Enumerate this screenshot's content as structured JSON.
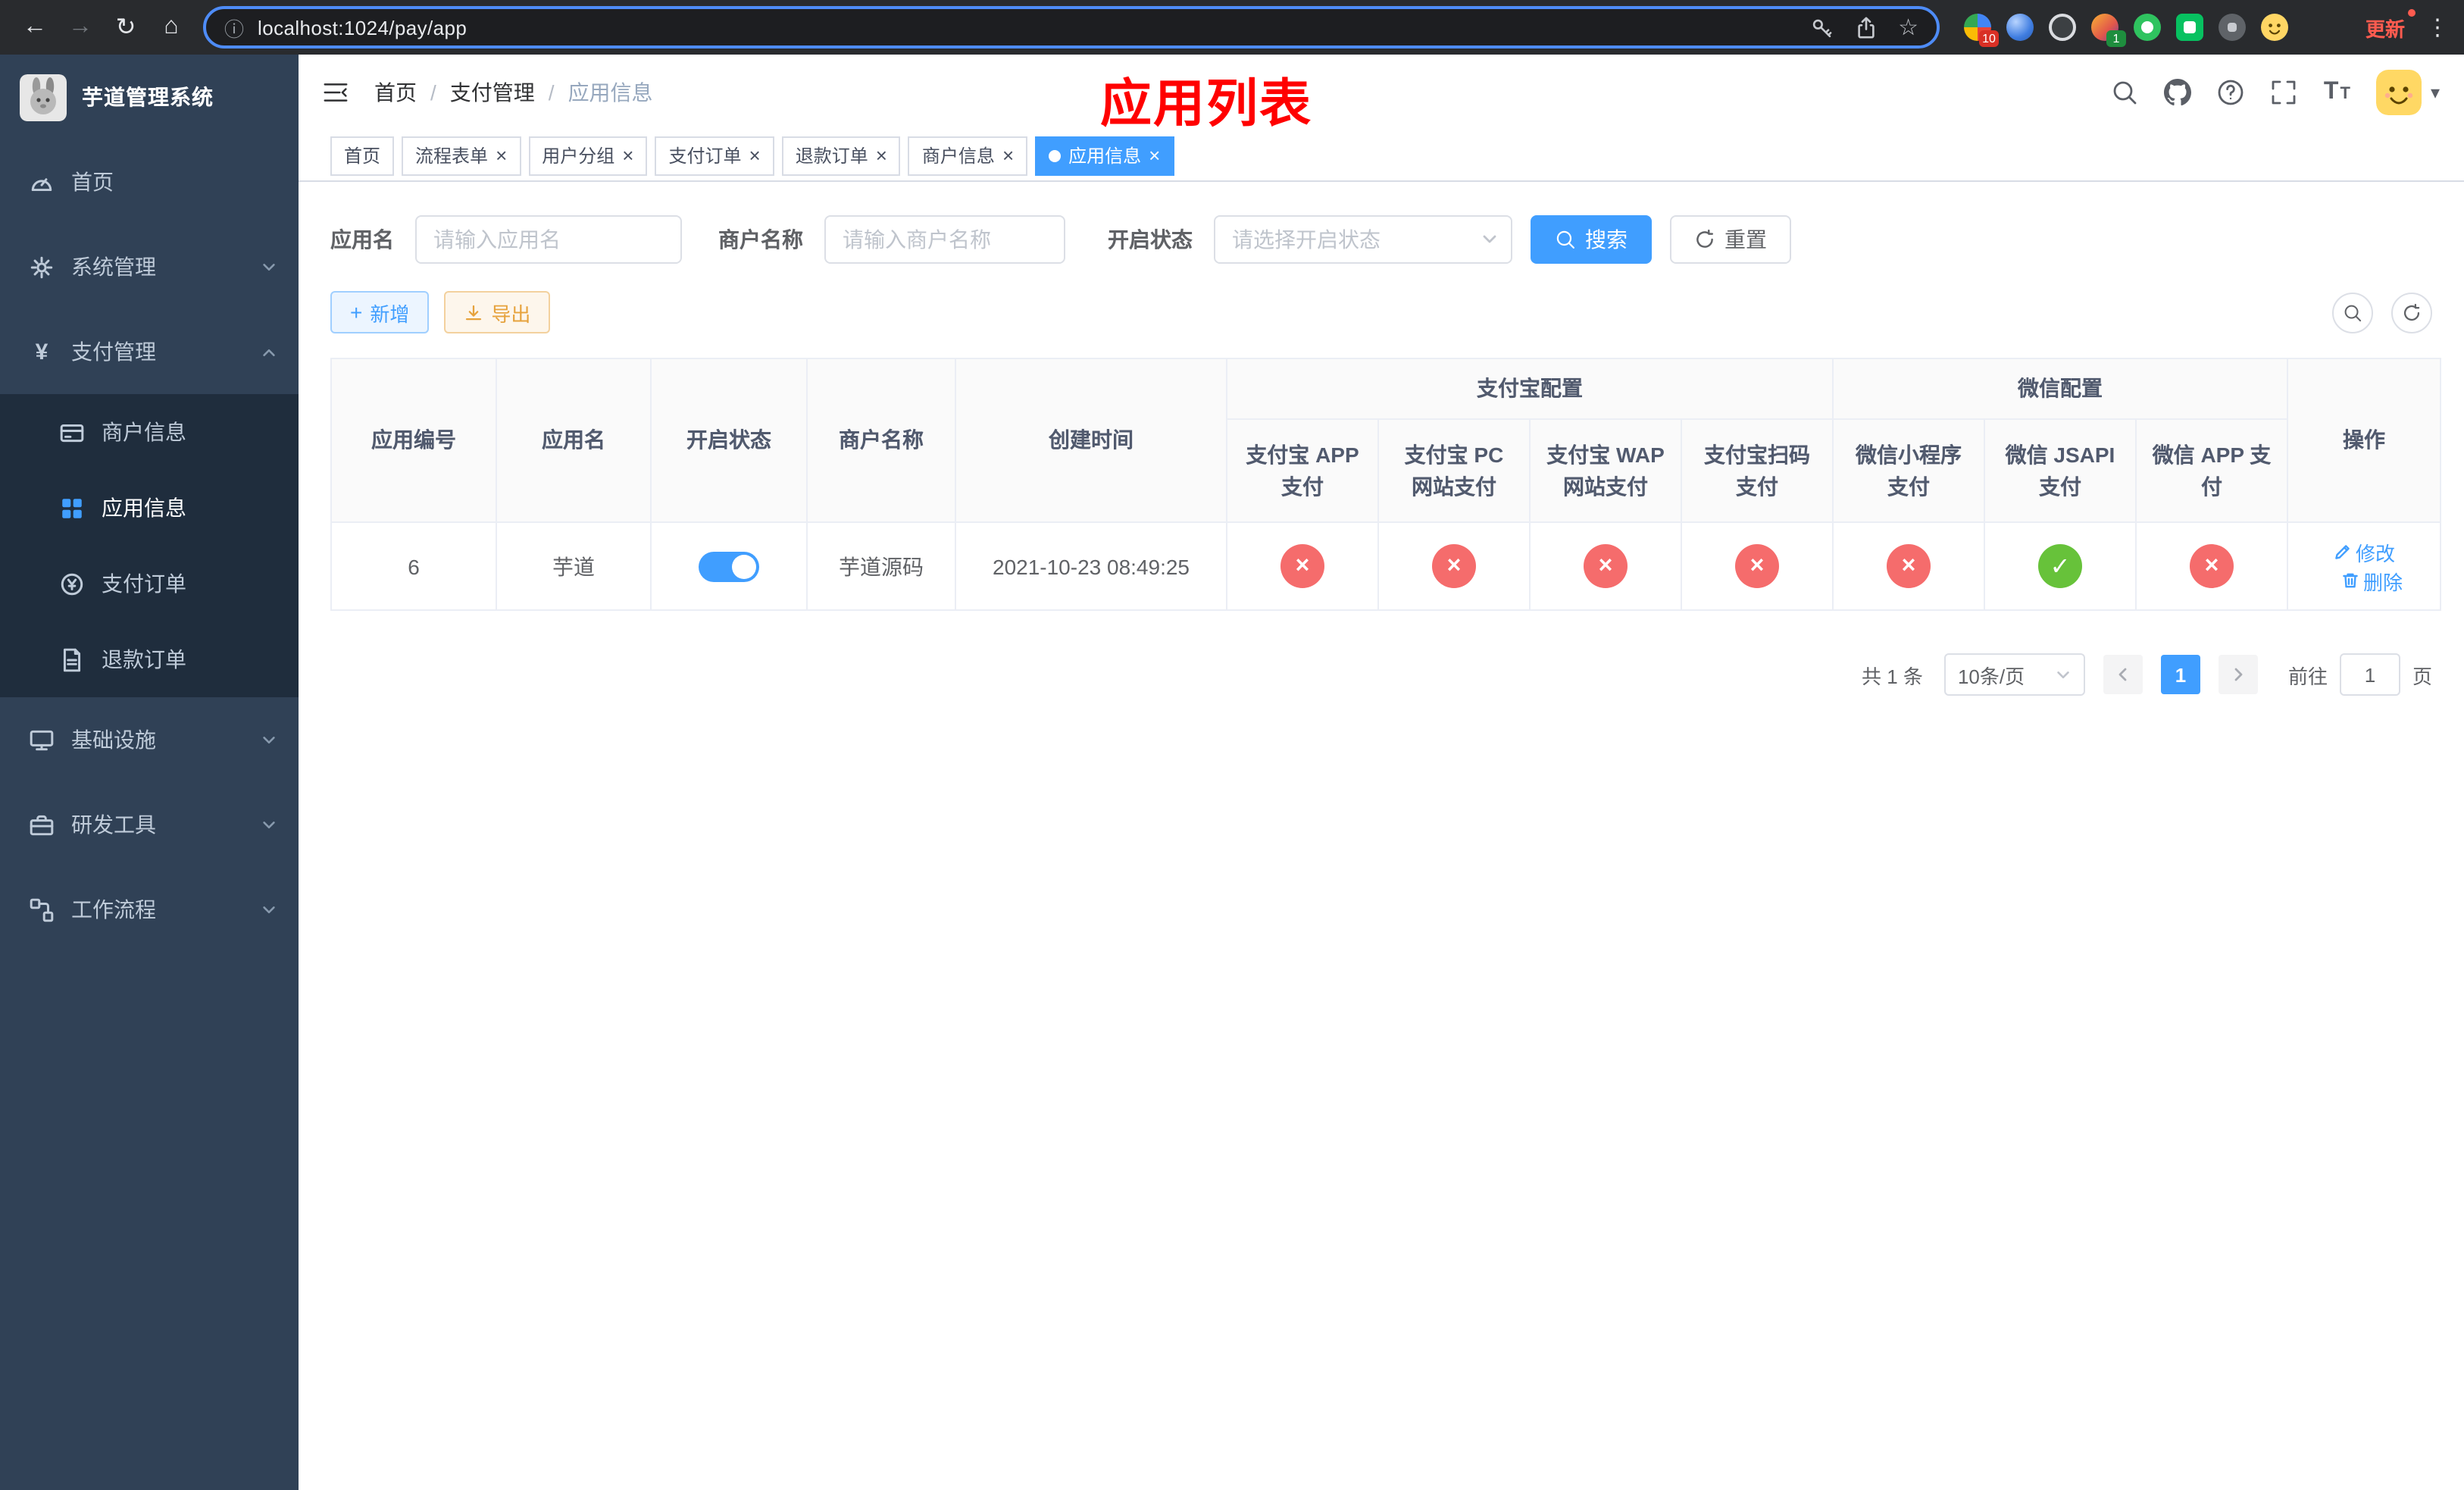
{
  "colors": {
    "accent": "#409EFF",
    "danger": "#f56c6c",
    "success": "#67c23a",
    "warning": "#e6a23c",
    "annotation": "#ff0000",
    "sidebar_bg": "#304156"
  },
  "glyphs": {
    "back": "←",
    "forward": "→",
    "reload": "↻",
    "home": "⌂",
    "info": "ⓘ",
    "star": "☆",
    "menu_dots": "⋮",
    "slash": "/",
    "close": "×",
    "plus": "+",
    "cross": "×",
    "check": "✓",
    "caret_down": "▾",
    "yen": "¥",
    "font_large": "T",
    "font_small": "T"
  },
  "browser": {
    "url": "localhost:1024/pay/app",
    "update_label": "更新",
    "extension_badge_grid": "10",
    "extension_badge_avatar": "1"
  },
  "sidebar": {
    "title": "芋道管理系统",
    "items": {
      "home": "首页",
      "system": "系统管理",
      "payment": "支付管理",
      "merchant": "商户信息",
      "app": "应用信息",
      "pay_order": "支付订单",
      "refund_order": "退款订单",
      "infra": "基础设施",
      "dev": "研发工具",
      "workflow": "工作流程"
    }
  },
  "header": {
    "breadcrumb_home": "首页",
    "breadcrumb_section": "支付管理",
    "breadcrumb_current": "应用信息",
    "annotation": "应用列表"
  },
  "tabs": [
    {
      "label": "首页",
      "closable": false,
      "active": false
    },
    {
      "label": "流程表单",
      "closable": true,
      "active": false
    },
    {
      "label": "用户分组",
      "closable": true,
      "active": false
    },
    {
      "label": "支付订单",
      "closable": true,
      "active": false
    },
    {
      "label": "退款订单",
      "closable": true,
      "active": false
    },
    {
      "label": "商户信息",
      "closable": true,
      "active": false
    },
    {
      "label": "应用信息",
      "closable": true,
      "active": true
    }
  ],
  "filters": {
    "app_name_label": "应用名",
    "app_name_placeholder": "请输入应用名",
    "merchant_label": "商户名称",
    "merchant_placeholder": "请输入商户名称",
    "status_label": "开启状态",
    "status_placeholder": "请选择开启状态",
    "search": "搜索",
    "reset": "重置"
  },
  "toolbar": {
    "add": "新增",
    "export": "导出"
  },
  "table": {
    "col_id": "应用编号",
    "col_name": "应用名",
    "col_status": "开启状态",
    "col_merchant": "商户名称",
    "col_created": "创建时间",
    "group_alipay": "支付宝配置",
    "group_wechat": "微信配置",
    "col_actions": "操作",
    "sub_cols": [
      "支付宝 APP 支付",
      "支付宝 PC 网站支付",
      "支付宝 WAP 网站支付",
      "支付宝扫码支付",
      "微信小程序支付",
      "微信 JSAPI 支付",
      "微信 APP 支付"
    ],
    "row": {
      "id": "6",
      "name": "芋道",
      "enabled": true,
      "merchant": "芋道源码",
      "created": "2021-10-23 08:49:25",
      "channels": [
        false,
        false,
        false,
        false,
        false,
        true,
        false
      ],
      "edit": "修改",
      "delete": "删除"
    }
  },
  "pagination": {
    "total": "共 1 条",
    "page_size": "10条/页",
    "page": "1",
    "goto": "前往",
    "goto_value": "1",
    "unit": "页"
  }
}
